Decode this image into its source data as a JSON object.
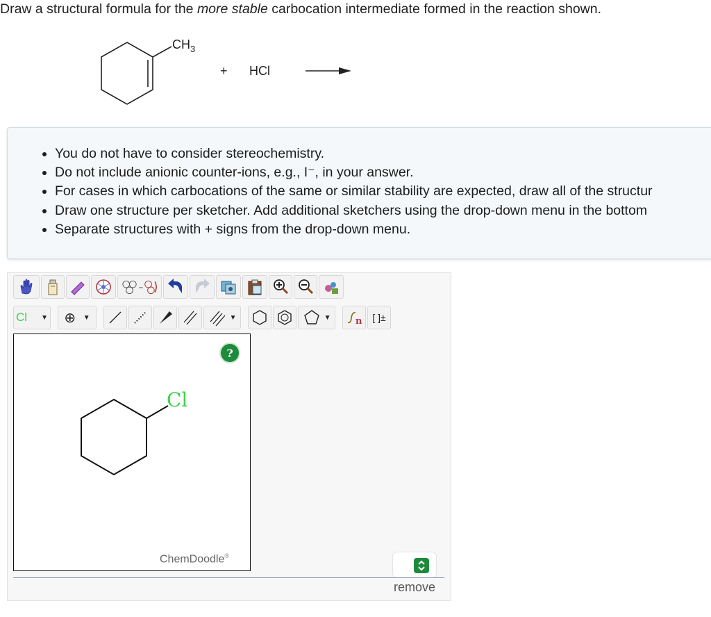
{
  "question": {
    "prefix": "Draw a structural formula for the ",
    "emphasis": "more stable",
    "suffix": " carbocation intermediate formed in the reaction shown."
  },
  "reaction": {
    "substituent": "CH",
    "substituent_subscript": "3",
    "plus": "+",
    "reagent": "HCl"
  },
  "instructions": [
    "You do not have to consider stereochemistry.",
    "Do not include anionic counter-ions, e.g., I⁻, in your answer.",
    "For cases in which carbocations of the same or similar stability are expected, draw all of the structur",
    "Draw one structure per sketcher. Add additional sketchers using the drop-down menu in the bottom",
    "Separate structures with + signs from the drop-down menu."
  ],
  "toolbar": {
    "element_label": "Cl",
    "charge_label": "⊕",
    "bracket_label": "[ ]±",
    "sgroup_label": "n"
  },
  "sketcher": {
    "help_label": "?",
    "atom_label": "Cl",
    "brand": "ChemDoodle",
    "brand_mark": "®"
  },
  "footer": {
    "remove_label": "remove"
  },
  "colors": {
    "accent_green": "#1e8a3c",
    "chlorine_green": "#3fcf4a",
    "panel_bg": "#f4f8fb"
  }
}
